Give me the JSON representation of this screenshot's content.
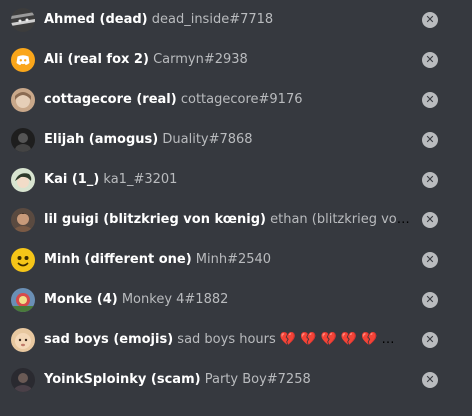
{
  "members": [
    {
      "nickname": "Ahmed (dead)",
      "username": "dead_inside#7718",
      "avatar_icon": "striped-face-avatar-icon",
      "avatar_color": "#4a4a4a"
    },
    {
      "nickname": "Ali (real fox 2)",
      "username": "Carmyn#2938",
      "avatar_icon": "discord-logo-icon",
      "avatar_color": "#faa61a"
    },
    {
      "nickname": "cottagecore (real)",
      "username": "cottagecore#9176",
      "avatar_icon": "anime-girl-avatar-icon",
      "avatar_color": "#c9a88a"
    },
    {
      "nickname": "Elijah (amogus)",
      "username": "Duality#7868",
      "avatar_icon": "dark-figure-avatar-icon",
      "avatar_color": "#2b2b2b"
    },
    {
      "nickname": "Kai (1_)",
      "username": "ka1_#3201",
      "avatar_icon": "anime-character-avatar-icon",
      "avatar_color": "#d8e4d0"
    },
    {
      "nickname": "lil guigi (blitzkrieg von kœnig)",
      "username": "ethan (blitzkrieg von koenig)#...",
      "avatar_icon": "portrait-avatar-icon",
      "avatar_color": "#8a6a55"
    },
    {
      "nickname": "Minh (different one)",
      "username": "Minh#2540",
      "avatar_icon": "yellow-emoji-avatar-icon",
      "avatar_color": "#f5c518"
    },
    {
      "nickname": "Monke (4)",
      "username": "Monkey 4#1882",
      "avatar_icon": "colorful-avatar-icon",
      "avatar_color": "#6a8fb5"
    },
    {
      "nickname": "sad boys (emojis)",
      "username": "sad boys hours 💔 💔 💔 💔 💔 🙄 🙄 🙄...",
      "avatar_icon": "baby-face-avatar-icon",
      "avatar_color": "#e8c8a0"
    },
    {
      "nickname": "YoinkSploinky (scam)",
      "username": "Party Boy#7258",
      "avatar_icon": "dark-portrait-avatar-icon",
      "avatar_color": "#3a3a40"
    }
  ],
  "remove_button_icon": "close-circle-icon"
}
